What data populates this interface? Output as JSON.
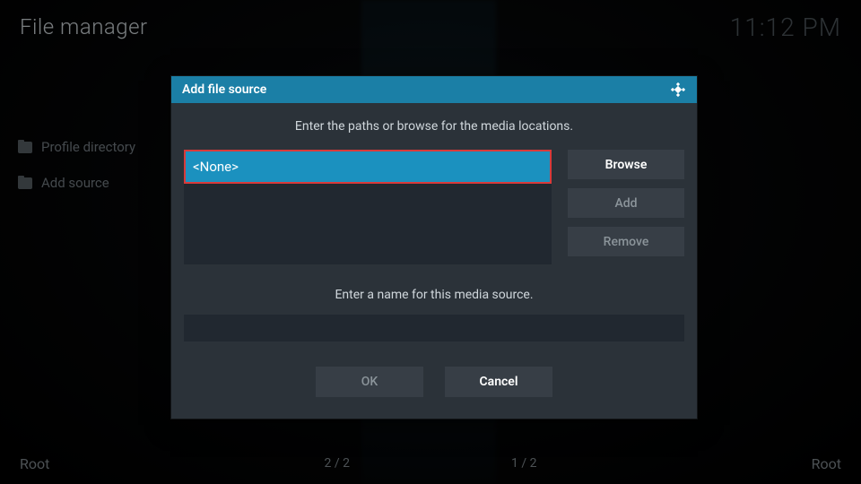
{
  "header": {
    "title": "File manager",
    "time": "11:12 PM"
  },
  "sidebar": {
    "items": [
      {
        "label": "Profile directory"
      },
      {
        "label": "Add source"
      }
    ]
  },
  "footer": {
    "left": "Root",
    "col_left_count": "2 / 2",
    "col_right_count": "1 / 2",
    "right": "Root"
  },
  "dialog": {
    "title": "Add file source",
    "paths_hint": "Enter the paths or browse for the media locations.",
    "path_value": "<None>",
    "browse_label": "Browse",
    "add_label": "Add",
    "remove_label": "Remove",
    "name_hint": "Enter a name for this media source.",
    "name_value": "",
    "ok_label": "OK",
    "cancel_label": "Cancel"
  }
}
